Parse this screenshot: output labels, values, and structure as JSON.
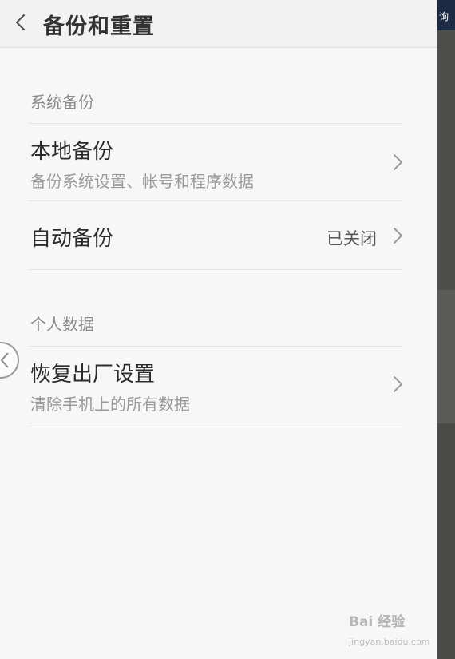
{
  "header": {
    "back_icon": "chevron-left-icon",
    "title": "备份和重置"
  },
  "sections": [
    {
      "header": "系统备份",
      "items": [
        {
          "title": "本地备份",
          "subtitle": "备份系统设置、帐号和程序数据",
          "value": "",
          "icon": "chevron-right-icon"
        },
        {
          "title": "自动备份",
          "subtitle": "",
          "value": "已关闭",
          "icon": "chevron-right-icon"
        }
      ]
    },
    {
      "header": "个人数据",
      "items": [
        {
          "title": "恢复出厂设置",
          "subtitle": "清除手机上的所有数据",
          "value": "",
          "icon": "chevron-right-icon"
        }
      ]
    }
  ],
  "overlay": {
    "right_edge_text": "询",
    "assist_icon": "floating-assist-icon"
  },
  "watermark": {
    "text": "Bai 经验",
    "url": "jingyan.baidu.com"
  }
}
